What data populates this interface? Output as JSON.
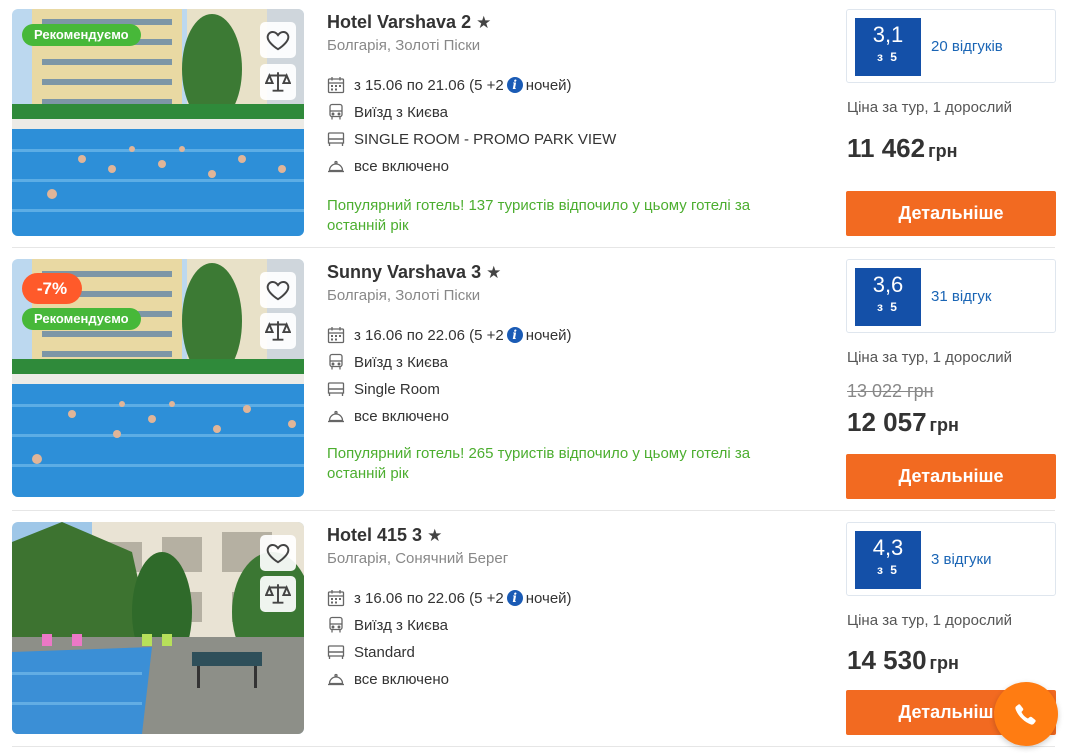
{
  "icons": {
    "favorite": "heart-icon",
    "compare": "scales-icon",
    "dates": "calendar-icon",
    "departure": "bus-icon",
    "room": "bed-icon",
    "meal": "food-dome-icon",
    "call": "phone-icon"
  },
  "colors": {
    "recommended_badge": "#47b839",
    "discount_badge": "#ff5a2a",
    "rating_box": "#1450a8",
    "details_button": "#f26a21",
    "popular_text": "#4cae2f",
    "link": "#1a65b5",
    "call_button": "#ff7c12"
  },
  "hotels": [
    {
      "name": "Hotel Varshava 2",
      "star": "★",
      "location": "Болгарія, Золоті Піски",
      "recommended": "Рекомендуємо",
      "discount": "",
      "dates_prefix": "з 15.06 по 21.06 (5 +2",
      "dates_suffix": "ночей)",
      "departure": "Виїзд з Києва",
      "room": "SINGLE ROOM - PROMO PARK VIEW",
      "meal": "все включено",
      "popular": "Популярний готель! 137 туристів відпочило у цьому готелі за останній рік",
      "rating": "3,1",
      "rating_of": "з 5",
      "reviews": "20 відгуків",
      "price_label": "Ціна за тур, 1 дорослий",
      "old_price": "",
      "price": "11 462",
      "currency": "грн",
      "button": "Детальніше"
    },
    {
      "name": "Sunny Varshava 3",
      "star": "★",
      "location": "Болгарія, Золоті Піски",
      "recommended": "Рекомендуємо",
      "discount": "-7%",
      "dates_prefix": "з 16.06 по 22.06 (5 +2",
      "dates_suffix": "ночей)",
      "departure": "Виїзд з Києва",
      "room": "Single Room",
      "meal": "все включено",
      "popular": "Популярний готель! 265 туристів відпочило у цьому готелі за останній рік",
      "rating": "3,6",
      "rating_of": "з 5",
      "reviews": "31 відгук",
      "price_label": "Ціна за тур, 1 дорослий",
      "old_price": "13 022 грн",
      "price": "12 057",
      "currency": "грн",
      "button": "Детальніше"
    },
    {
      "name": "Hotel 415 3",
      "star": "★",
      "location": "Болгарія, Сонячний Берег",
      "recommended": "",
      "discount": "",
      "dates_prefix": "з 16.06 по 22.06 (5 +2",
      "dates_suffix": "ночей)",
      "departure": "Виїзд з Києва",
      "room": "Standard",
      "meal": "все включено",
      "popular": "",
      "rating": "4,3",
      "rating_of": "з 5",
      "reviews": "3 відгуки",
      "price_label": "Ціна за тур, 1 дорослий",
      "old_price": "",
      "price": "14 530",
      "currency": "грн",
      "button": "Детальніше"
    }
  ]
}
